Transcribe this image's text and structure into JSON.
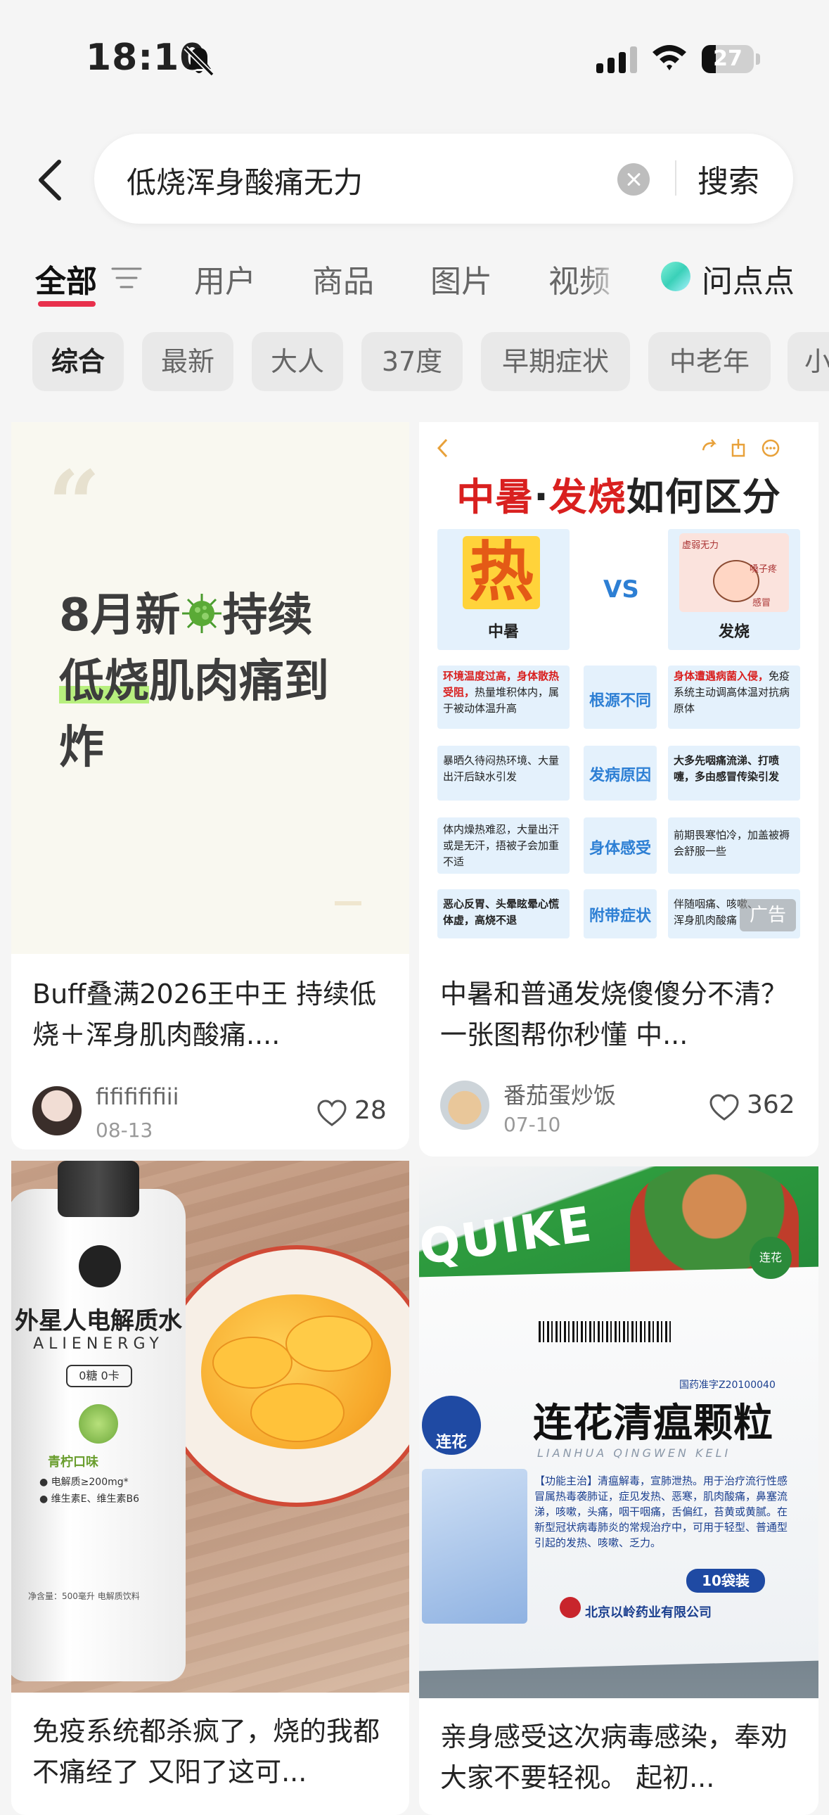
{
  "status_bar": {
    "time": "18:10",
    "battery": "27",
    "battery_level": 0.27
  },
  "search": {
    "query": "低烧浑身酸痛无力",
    "button": "搜索"
  },
  "tabs": [
    {
      "label": "全部"
    },
    {
      "label": "用户"
    },
    {
      "label": "商品"
    },
    {
      "label": "图片"
    },
    {
      "label": "视频"
    },
    {
      "label": "问点点"
    }
  ],
  "filters": [
    "综合",
    "最新",
    "大人",
    "37度",
    "早期症状",
    "中老年",
    "小"
  ],
  "cards": [
    {
      "cover_text": {
        "line1_a": "8月新",
        "line1_b": "持续",
        "line2_hl": "低烧",
        "line2_rest": "肌肉痛到",
        "line3": "炸"
      },
      "title": "Buff叠满2026王中王 持续低烧＋浑身肌肉酸痛....",
      "author": "fififififiii",
      "date": "08-13",
      "likes": "28"
    },
    {
      "title": "中暑和普通发烧傻傻分不清？一张图帮你秒懂 中...",
      "author": "番茄蛋炒饭",
      "date": "07-10",
      "likes": "362",
      "ad": "广告",
      "infographic": {
        "title_red1": "中暑",
        "title_dot": "·",
        "title_red2": "发烧",
        "title_rest": "如何区分",
        "hot_char": "热",
        "left_label": "中暑",
        "vs": "VS",
        "right_label": "发烧",
        "bubble1": "虚弱无力",
        "bubble2": "嗓子疼",
        "bubble3": "感冒",
        "rows": [
          {
            "mid": "根源不同",
            "left_red": "环境温度过高，身体散热受阻，",
            "left": "热量堆积体内，属于被动体温升高",
            "right_red": "身体遭遇病菌入侵，",
            "right": "免疫系统主动调高体温对抗病原体"
          },
          {
            "mid": "发病原因",
            "left": "暴晒久待闷热环境、大量出汗后缺水引发",
            "right": "大多先咽痛流涕、打喷嚏，多由感冒传染引发"
          },
          {
            "mid": "身体感受",
            "left": "体内燥热难忍，大量出汗或是无汗，捂被子会加重不适",
            "right": "前期畏寒怕冷，加盖被褥会舒服一些"
          },
          {
            "mid": "附带症状",
            "left": "恶心反胃、头晕眩晕心慌体虚，高烧不退",
            "right": "伴随咽痛、咳嗽、浑身肌肉酸痛"
          }
        ]
      }
    },
    {
      "title": "免疫系统都杀疯了，烧的我都不痛经了 又阳了这可...",
      "bottle": {
        "brand": "外星人电解质水",
        "brand_en": "ALIENERGY",
        "tag": "0糖 0卡",
        "flavor": "青柠口味",
        "spec1": "● 电解质≥200mg*",
        "spec2": "● 维生素E、维生素B6",
        "volume": "净含量：500毫升 电解质饮料"
      }
    },
    {
      "title": "亲身感受这次病毒感染，奉劝大家不要轻视。 起初...",
      "box": {
        "brand_en": "QUIKE",
        "approval": "国药准字Z20100040",
        "brand": "连花",
        "name": "连花清瘟颗粒",
        "pinyin": "LIANHUA QINGWEN KELI",
        "desc": "【功能主治】清瘟解毒，宣肺泄热。用于治疗流行性感冒属热毒袭肺证，症见发热、恶寒，肌肉酸痛，鼻塞流涕，咳嗽，头痛，咽干咽痛，舌偏红，苔黄或黄腻。在新型冠状病毒肺炎的常规治疗中，可用于轻型、普通型引起的发热、咳嗽、乏力。",
        "count": "10袋装",
        "maker": "北京以岭药业有限公司",
        "tag": "连花"
      }
    }
  ]
}
